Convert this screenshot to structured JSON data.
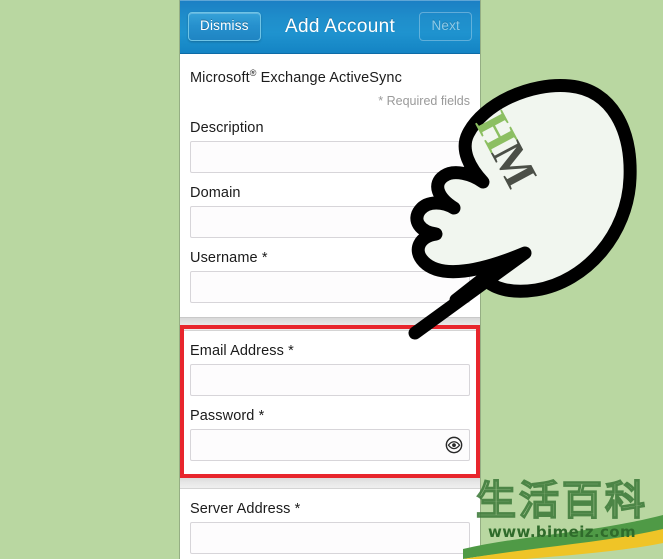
{
  "background_color": "#b9d7a1",
  "header": {
    "dismiss_label": "Dismiss",
    "title": "Add Account",
    "next_label": "Next",
    "accent_color": "#1f8ecb"
  },
  "form": {
    "section_title_prefix": "Microsoft",
    "section_title_reg": "®",
    "section_title_suffix": " Exchange ActiveSync",
    "required_note": "* Required fields",
    "fields": [
      {
        "label": "Description",
        "value": "",
        "placeholder": "",
        "required": false,
        "type": "text"
      },
      {
        "label": "Domain",
        "value": "",
        "placeholder": "",
        "required": false,
        "type": "text"
      },
      {
        "label": "Username *",
        "value": "",
        "placeholder": "",
        "required": true,
        "type": "text"
      },
      {
        "label": "Email Address *",
        "value": "",
        "placeholder": "",
        "required": true,
        "type": "text"
      },
      {
        "label": "Password *",
        "value": "",
        "placeholder": "",
        "required": true,
        "type": "password"
      },
      {
        "label": "Server Address *",
        "value": "",
        "placeholder": "",
        "required": true,
        "type": "text"
      }
    ],
    "password_toggle_icon": "eye-icon"
  },
  "annotation": {
    "highlight_color": "#e8262d",
    "highlighted_fields": [
      "Email Address *",
      "Password *"
    ],
    "hand_icon": "pointing-hand-icon",
    "hand_letters": {
      "first": "H",
      "second": "M",
      "first_color": "#8cbf62",
      "second_color": "#4b4f47"
    }
  },
  "watermark": {
    "cjk_text": "生活百科",
    "url": "www.bimeiz.com",
    "color": "#2f6b2b"
  }
}
